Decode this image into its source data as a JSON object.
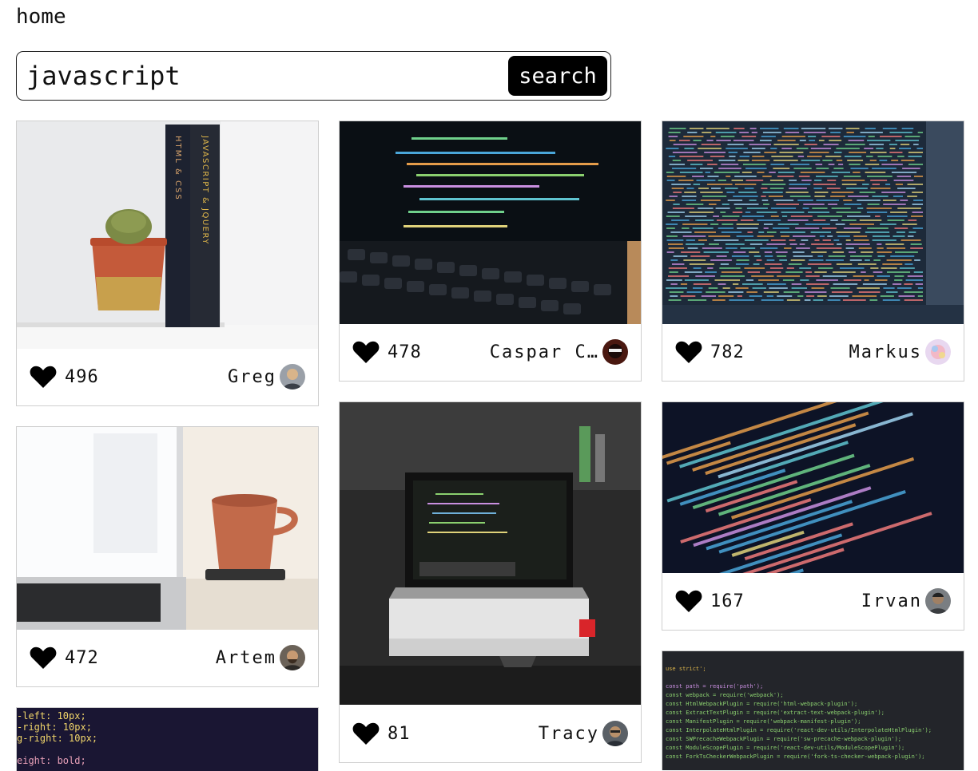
{
  "nav": {
    "home_label": "home"
  },
  "search": {
    "query": "javascript",
    "button_label": "search"
  },
  "cards": [
    {
      "likes": "496",
      "author": "Greg",
      "photo": "cactus-and-books"
    },
    {
      "likes": "478",
      "author": "Caspar C…",
      "photo": "laptop-keyboard-code"
    },
    {
      "likes": "782",
      "author": "Markus",
      "photo": "colorful-code-screen"
    },
    {
      "likes": "472",
      "author": "Artem",
      "photo": "laptop-and-mug"
    },
    {
      "likes": "81",
      "author": "Tracy",
      "photo": "macbook-on-box"
    },
    {
      "likes": "167",
      "author": "Irvan",
      "photo": "js-code-closeup"
    },
    {
      "likes": "",
      "author": "",
      "photo": "css-code-snippet"
    },
    {
      "likes": "",
      "author": "",
      "photo": "webpack-config-code"
    }
  ],
  "photo_text": {
    "book1_title": "HTML & CSS",
    "book2_title": "JAVASCRIPT & JQUERY",
    "css_snippet": [
      "-left: 10px;",
      "-right: 10px;",
      "g-right: 10px;",
      "eight: bold;"
    ],
    "webpack_snippet": [
      "use strict';",
      "const path = require('path');",
      "const webpack = require('webpack');",
      "const HtmlWebpackPlugin = require('html-webpack-plugin');",
      "const ExtractTextPlugin = require('extract-text-webpack-plugin');",
      "const ManifestPlugin = require('webpack-manifest-plugin');",
      "const InterpolateHtmlPlugin = require('react-dev-utils/InterpolateHtmlPlugin');",
      "const SWPrecacheWebpackPlugin = require('sw-precache-webpack-plugin');",
      "const ModuleScopePlugin = require('react-dev-utils/ModuleScopePlugin');",
      "const ForkTsCheckerWebpackPlugin = require('fork-ts-checker-webpack-plugin');"
    ]
  },
  "icons": {
    "like": "heart-icon",
    "avatar": "user-avatar"
  },
  "colors": {
    "button_bg": "#000000",
    "border": "#cfcfcf",
    "text": "#111111"
  }
}
